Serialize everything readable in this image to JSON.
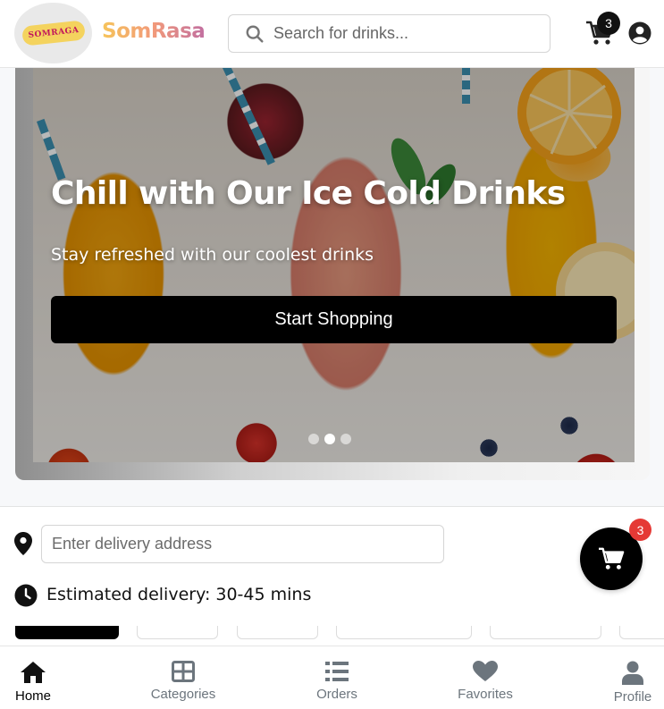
{
  "header": {
    "logo_text": "SOMRAGA",
    "brand": "SomRasa",
    "search_placeholder": "Search for drinks...",
    "cart_count": "3"
  },
  "hero": {
    "title": "Chill with Our Ice Cold Drinks",
    "subtitle": "Stay refreshed with our coolest drinks",
    "cta_label": "Start Shopping",
    "slides_total": 3,
    "active_slide": 2
  },
  "delivery": {
    "address_placeholder": "Enter delivery address",
    "estimate": "Estimated delivery: 30-45 mins"
  },
  "floating_cart": {
    "count": "3"
  },
  "bottom_nav": {
    "items": [
      {
        "label": "Home",
        "icon": "home-icon",
        "active": true
      },
      {
        "label": "Categories",
        "icon": "grid-icon",
        "active": false
      },
      {
        "label": "Orders",
        "icon": "list-icon",
        "active": false
      },
      {
        "label": "Favorites",
        "icon": "heart-icon",
        "active": false
      },
      {
        "label": "Profile",
        "icon": "user-icon",
        "active": false
      }
    ]
  },
  "colors": {
    "accent": "#000000",
    "badge_red": "#e53935",
    "brand_gradient_start": "#f6c45a",
    "brand_gradient_end": "#c26fa0"
  }
}
